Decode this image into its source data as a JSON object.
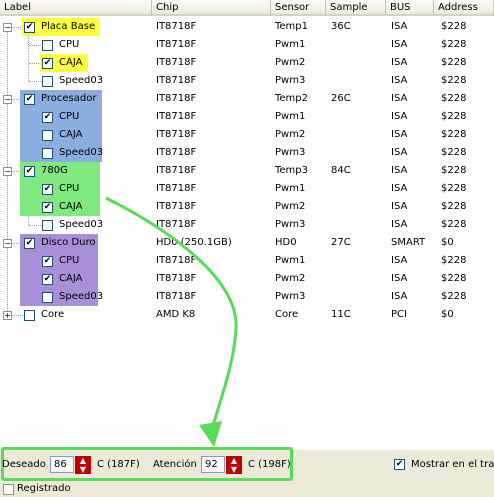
{
  "columns": [
    "Label",
    "Chip",
    "Sensor",
    "Sample",
    "BUS",
    "Address"
  ],
  "rows": [
    {
      "label": "Placa Base",
      "chip": "IT8718F",
      "sensor": "Temp1",
      "sample": "36C",
      "bus": "ISA",
      "address": "$228",
      "level": 0,
      "expander": "−",
      "checked": true
    },
    {
      "label": "CPU",
      "chip": "IT8718F",
      "sensor": "Pwm1",
      "sample": "",
      "bus": "ISA",
      "address": "$228",
      "level": 1,
      "checked": false
    },
    {
      "label": "CAJA",
      "chip": "IT8718F",
      "sensor": "Pwm2",
      "sample": "",
      "bus": "ISA",
      "address": "$228",
      "level": 1,
      "checked": true
    },
    {
      "label": "Speed03",
      "chip": "IT8718F",
      "sensor": "Pwm3",
      "sample": "",
      "bus": "ISA",
      "address": "$228",
      "level": 1,
      "checked": false
    },
    {
      "label": "Procesador",
      "chip": "IT8718F",
      "sensor": "Temp2",
      "sample": "26C",
      "bus": "ISA",
      "address": "$228",
      "level": 0,
      "expander": "−",
      "checked": true
    },
    {
      "label": "CPU",
      "chip": "IT8718F",
      "sensor": "Pwm1",
      "sample": "",
      "bus": "ISA",
      "address": "$228",
      "level": 1,
      "checked": true
    },
    {
      "label": "CAJA",
      "chip": "IT8718F",
      "sensor": "Pwm2",
      "sample": "",
      "bus": "ISA",
      "address": "$228",
      "level": 1,
      "checked": false
    },
    {
      "label": "Speed03",
      "chip": "IT8718F",
      "sensor": "Pwm3",
      "sample": "",
      "bus": "ISA",
      "address": "$228",
      "level": 1,
      "checked": false
    },
    {
      "label": "780G",
      "chip": "IT8718F",
      "sensor": "Temp3",
      "sample": "84C",
      "bus": "ISA",
      "address": "$228",
      "level": 0,
      "expander": "−",
      "checked": true
    },
    {
      "label": "CPU",
      "chip": "IT8718F",
      "sensor": "Pwm1",
      "sample": "",
      "bus": "ISA",
      "address": "$228",
      "level": 1,
      "checked": true
    },
    {
      "label": "CAJA",
      "chip": "IT8718F",
      "sensor": "Pwm2",
      "sample": "",
      "bus": "ISA",
      "address": "$228",
      "level": 1,
      "checked": true
    },
    {
      "label": "Speed03",
      "chip": "IT8718F",
      "sensor": "Pwm3",
      "sample": "",
      "bus": "ISA",
      "address": "$228",
      "level": 1,
      "checked": false
    },
    {
      "label": "Disco Duro",
      "chip": "HD0 (250.1GB)",
      "sensor": "HD0",
      "sample": "27C",
      "bus": "SMART",
      "address": "$0",
      "level": 0,
      "expander": "−",
      "checked": true
    },
    {
      "label": "CPU",
      "chip": "IT8718F",
      "sensor": "Pwm1",
      "sample": "",
      "bus": "ISA",
      "address": "$228",
      "level": 1,
      "checked": true
    },
    {
      "label": "CAJA",
      "chip": "IT8718F",
      "sensor": "Pwm2",
      "sample": "",
      "bus": "ISA",
      "address": "$228",
      "level": 1,
      "checked": true
    },
    {
      "label": "Speed03",
      "chip": "IT8718F",
      "sensor": "Pwm3",
      "sample": "",
      "bus": "ISA",
      "address": "$228",
      "level": 1,
      "checked": false
    },
    {
      "label": "Core",
      "chip": "AMD K8",
      "sensor": "Core",
      "sample": "11C",
      "bus": "PCI",
      "address": "$0",
      "level": 0,
      "expander": "+",
      "checked": false
    }
  ],
  "highlights": {
    "yellow": "#ffff40",
    "blue": "#8aaee0",
    "green": "#7fe87f",
    "purple": "#a98fd8",
    "annotation_green": "#55dd55"
  },
  "footer": {
    "deseado_label": "Deseado",
    "deseado_value": "86",
    "deseado_unit": "C (187F)",
    "atencion_label": "Atención",
    "atencion_value": "92",
    "atencion_unit": "C (198F)",
    "tray_label": "Mostrar en el tray",
    "tray_checked": true,
    "registrado_label": "Registrado",
    "registrado_checked": false
  },
  "icons": {
    "checkmark": "✔",
    "spin": "spin-arrows-icon",
    "arrow": "annotation-arrow"
  }
}
